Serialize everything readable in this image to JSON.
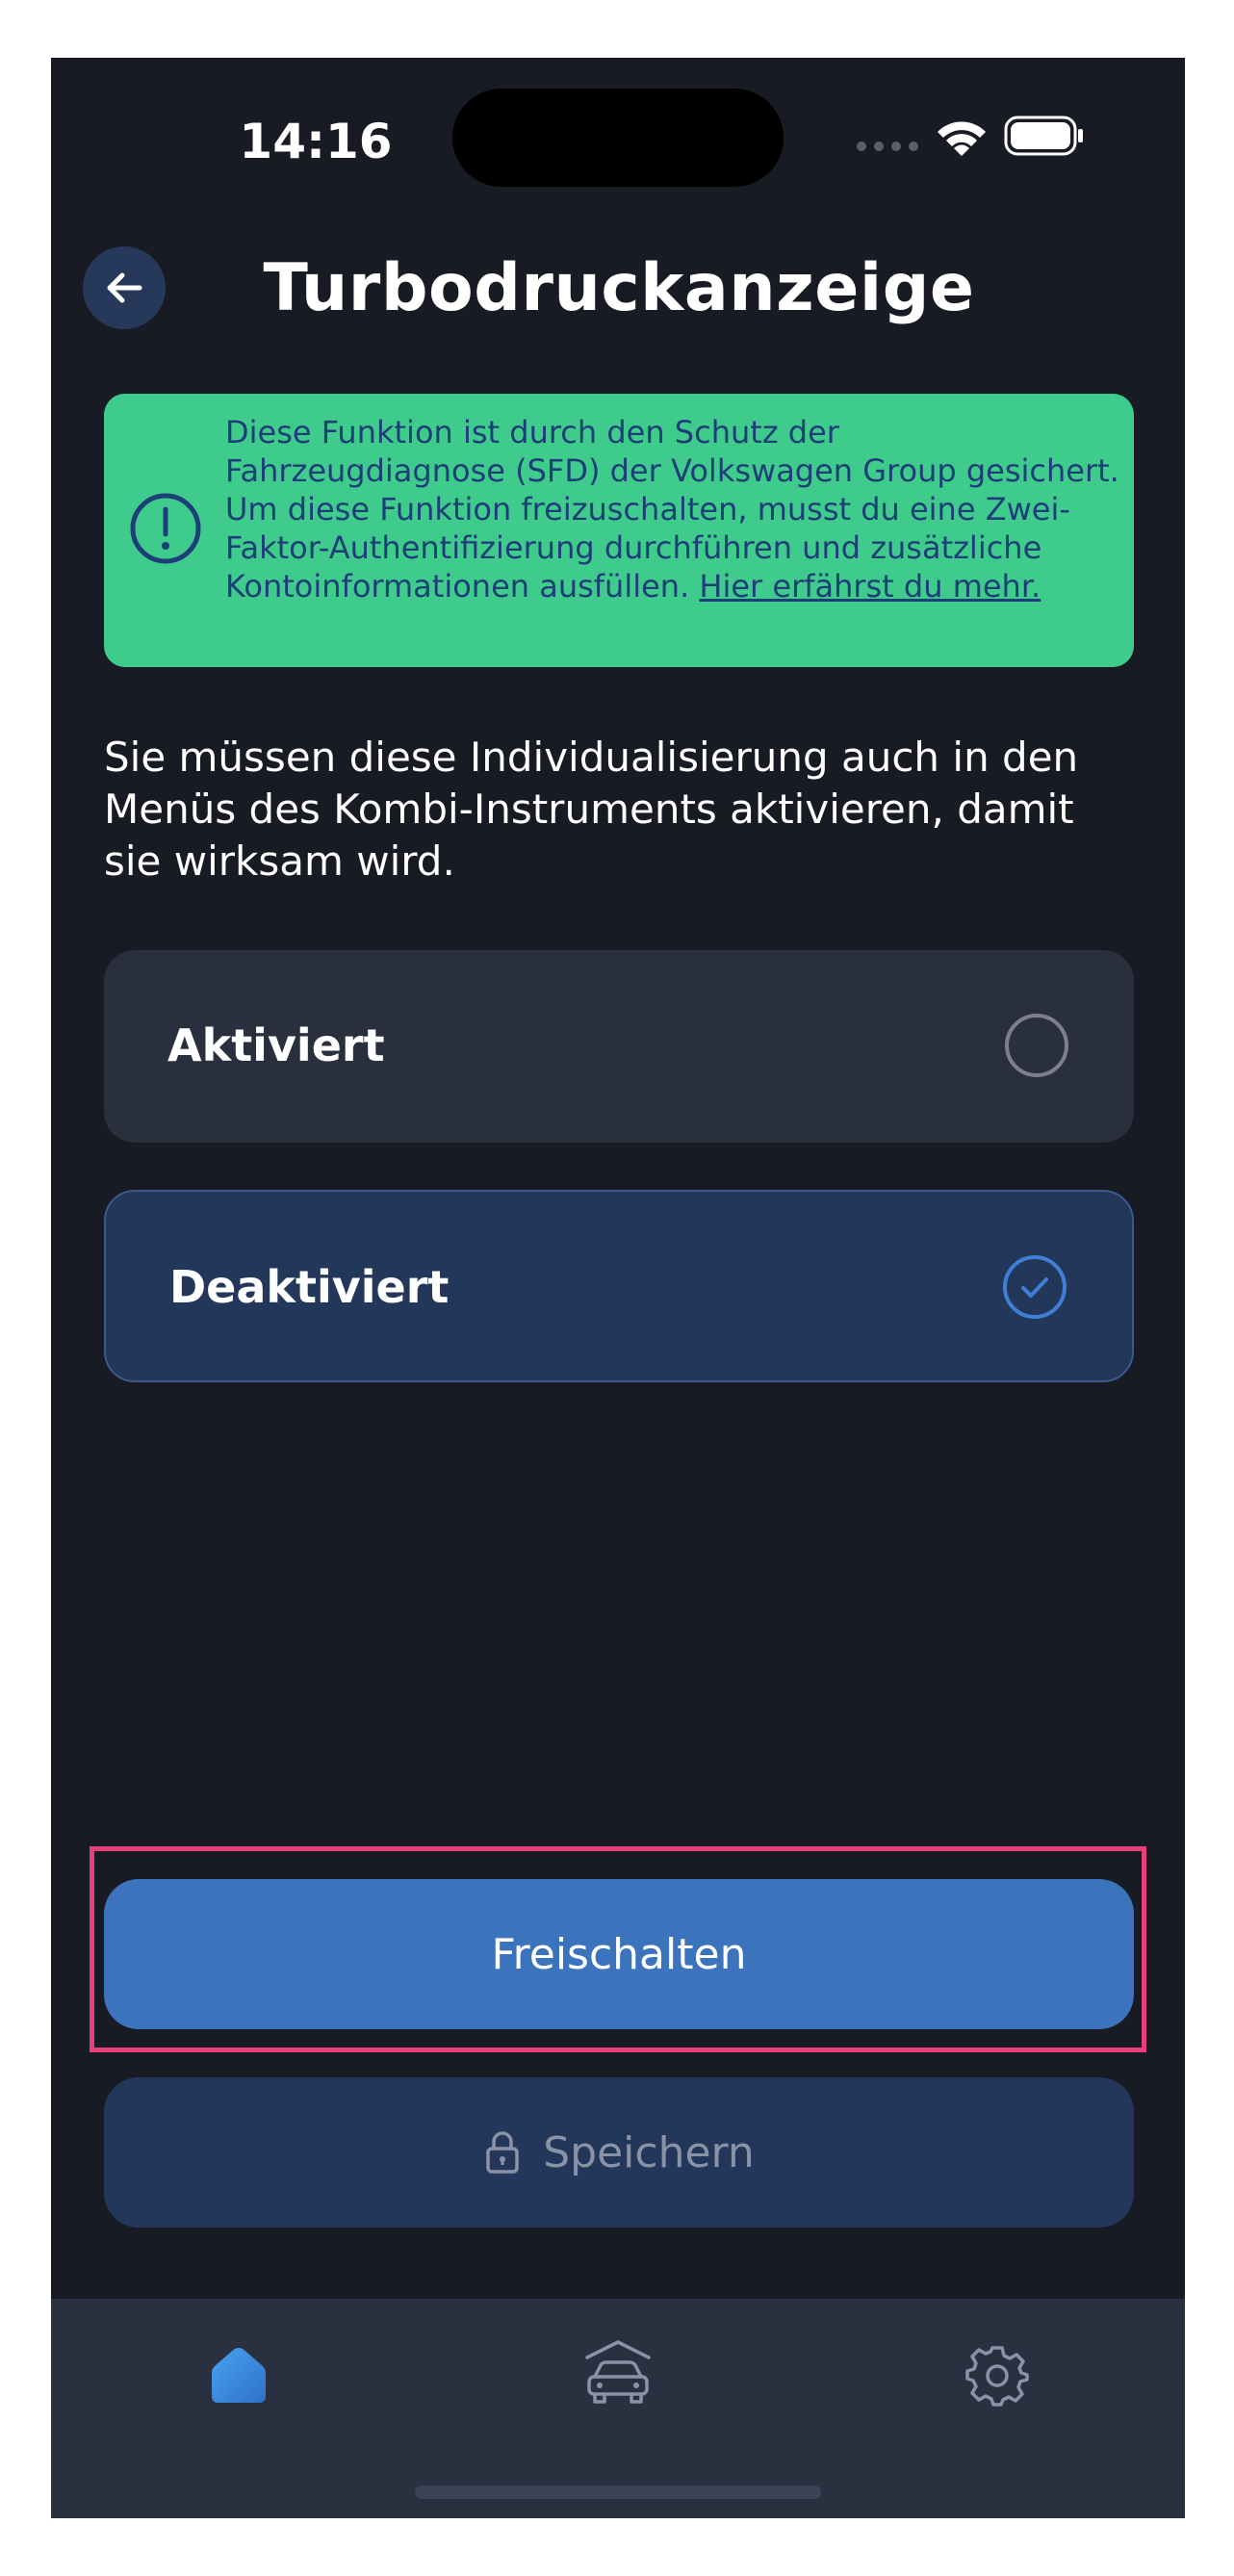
{
  "status_bar": {
    "time": "14:16"
  },
  "header": {
    "title": "Turbodruckanzeige",
    "back_icon": "arrow-left-icon"
  },
  "notice": {
    "icon": "exclamation-circle-icon",
    "text": "Diese Funktion ist durch den Schutz der Fahrzeugdiagnose (SFD) der Volkswagen Group gesichert. Um diese Funktion freizuschalten, musst du eine Zwei-Faktor-Authentifizierung durchführen und zusätzliche Kontoinformationen ausfüllen. ",
    "link_text": "Hier erfährst du mehr.",
    "background_color": "#3ecb8b",
    "text_color": "#1d3f78"
  },
  "description": "Sie müssen diese Individualisierung auch in den Menüs des Kombi-Instruments aktivieren, damit sie wirksam wird.",
  "options": [
    {
      "label": "Aktiviert",
      "selected": false
    },
    {
      "label": "Deaktiviert",
      "selected": true
    }
  ],
  "buttons": {
    "unlock_label": "Freischalten",
    "save_label": "Speichern",
    "save_icon": "lock-icon",
    "accent_color": "#3b73bd"
  },
  "bottom_nav": {
    "items": [
      {
        "icon": "home-icon",
        "active": true
      },
      {
        "icon": "car-icon",
        "active": false
      },
      {
        "icon": "gear-icon",
        "active": false
      }
    ]
  }
}
